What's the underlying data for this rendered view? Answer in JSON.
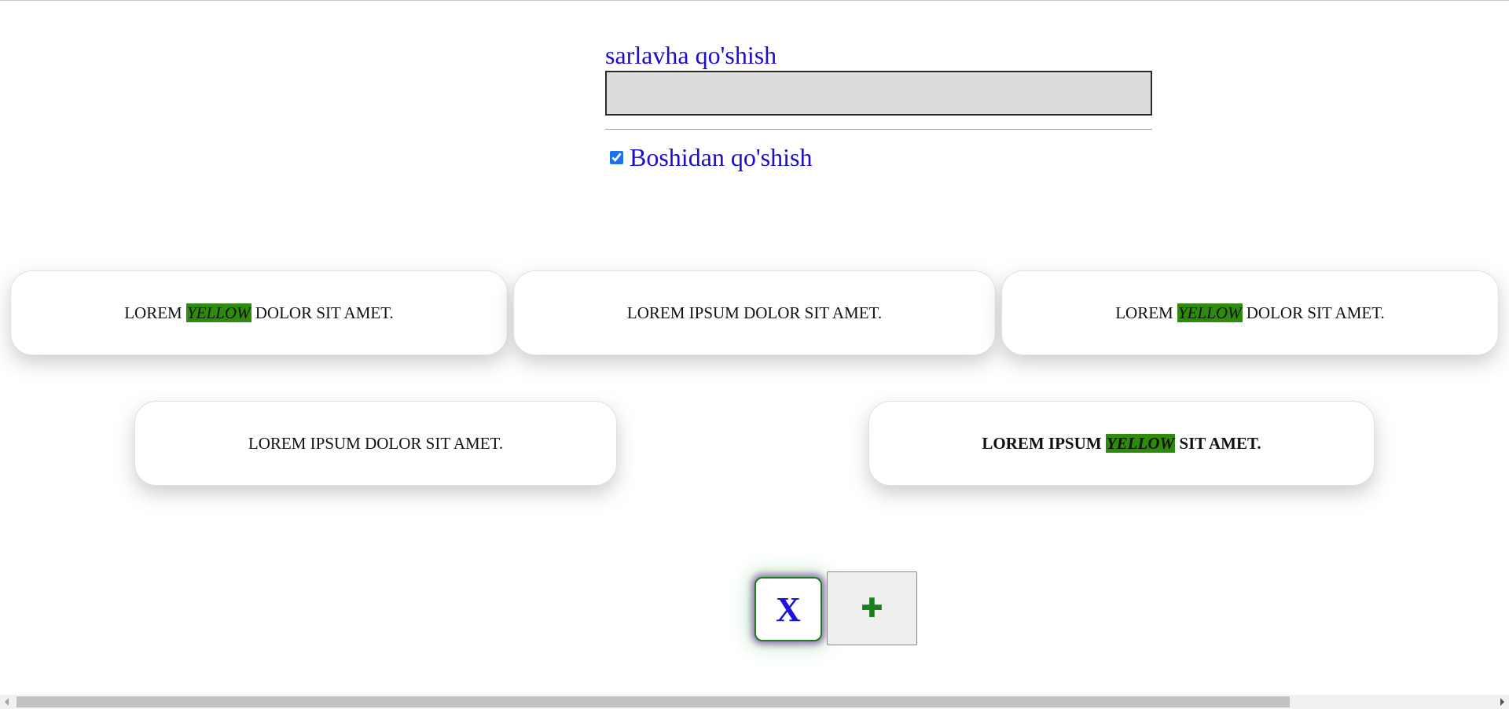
{
  "form": {
    "title_label": "sarlavha qo'shish",
    "title_input_value": "",
    "checkbox_checked": true,
    "checkbox_label": "Boshidan qo'shish"
  },
  "cards": [
    {
      "parts": [
        "LOREM ",
        "YELLOW",
        " DOLOR SIT AMET."
      ],
      "bold": false
    },
    {
      "text": "LOREM IPSUM DOLOR SIT AMET.",
      "bold": false
    },
    {
      "parts": [
        "LOREM ",
        "YELLOW",
        " DOLOR SIT AMET."
      ],
      "bold": false
    },
    {
      "text": "LOREM IPSUM DOLOR SIT AMET.",
      "bold": false
    },
    {
      "parts": [
        "LOREM IPSUM ",
        "YELLOW",
        " SIT AMET."
      ],
      "bold": true
    }
  ],
  "buttons": {
    "delete_label": "X",
    "add_label": "✚"
  },
  "colors": {
    "label_text": "#1a0dcc",
    "highlight_bg": "#2e8b0b",
    "delete_text": "#1a10e0",
    "add_text": "#1b7d1b"
  },
  "icons": {
    "scroll_left": "chevron-left-icon",
    "scroll_right": "chevron-right-icon"
  }
}
